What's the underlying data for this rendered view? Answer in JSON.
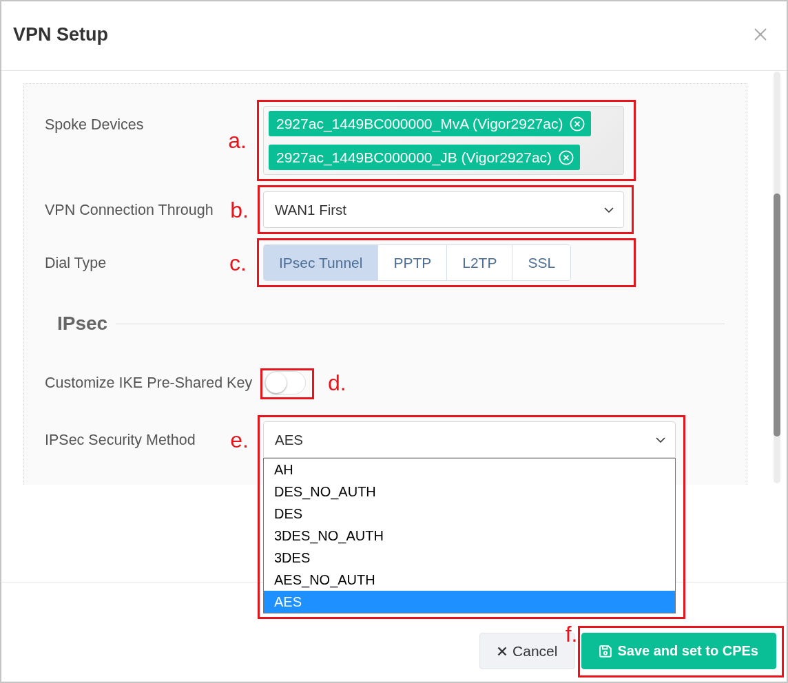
{
  "window": {
    "title": "VPN Setup"
  },
  "form": {
    "rows": [
      {
        "kind": "tags",
        "label": "Spoke Devices",
        "annotation": "a.",
        "tags": [
          "2927ac_1449BC000000_MvA (Vigor2927ac)",
          "2927ac_1449BC000000_JB (Vigor2927ac)"
        ]
      },
      {
        "kind": "select",
        "label": "VPN Connection Through",
        "annotation": "b.",
        "value": "WAN1 First",
        "expanded": false
      },
      {
        "kind": "segmented",
        "label": "Dial Type",
        "annotation": "c.",
        "options": [
          {
            "label": "IPsec Tunnel",
            "selected": true
          },
          {
            "label": "PPTP",
            "selected": false
          },
          {
            "label": "L2TP",
            "selected": false
          },
          {
            "label": "SSL",
            "selected": false
          }
        ]
      },
      {
        "kind": "heading",
        "label": "IPsec"
      },
      {
        "kind": "toggle",
        "label": "Customize IKE Pre-Shared Key",
        "annotation": "d.",
        "on": false
      },
      {
        "kind": "select",
        "label": "IPSec Security Method",
        "annotation": "e.",
        "value": "AES",
        "expanded": true,
        "options": [
          {
            "label": "AH",
            "selected": false
          },
          {
            "label": "DES_NO_AUTH",
            "selected": false
          },
          {
            "label": "DES",
            "selected": false
          },
          {
            "label": "3DES_NO_AUTH",
            "selected": false
          },
          {
            "label": "3DES",
            "selected": false
          },
          {
            "label": "AES_NO_AUTH",
            "selected": false
          },
          {
            "label": "AES",
            "selected": true
          }
        ]
      }
    ]
  },
  "footer": {
    "buttons": [
      {
        "kind": "secondary",
        "label": "Cancel"
      },
      {
        "kind": "primary",
        "label": "Save and set to CPEs",
        "annotation": "f."
      }
    ]
  }
}
